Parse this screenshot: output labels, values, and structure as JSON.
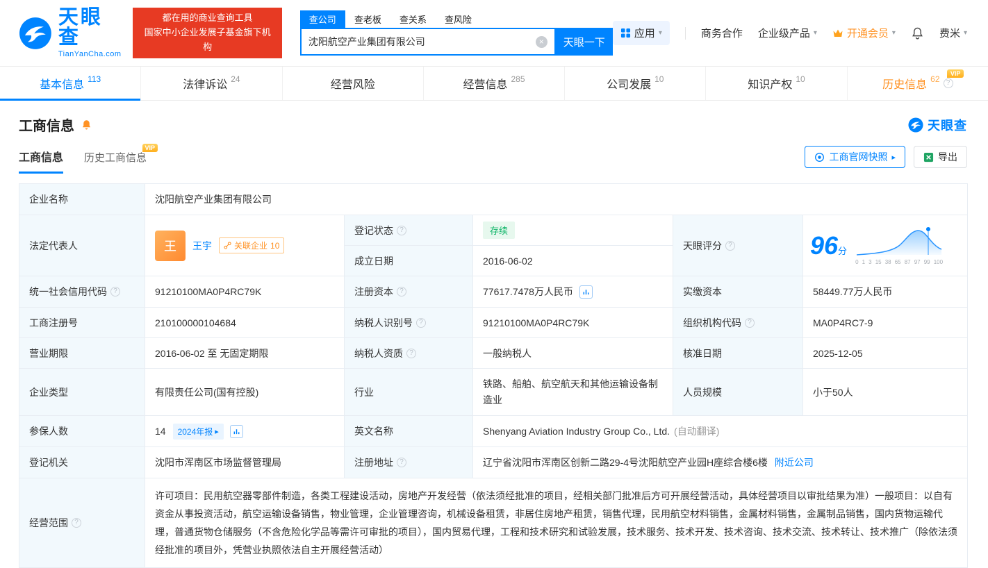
{
  "colors": {
    "brand_blue": "#0084ff",
    "vip_orange": "#ff9224",
    "status_green": "#0fb568",
    "promo_red": "#e73a23"
  },
  "vip_label": "VIP",
  "header": {
    "logo": {
      "brand": "天眼查",
      "domain": "TianYanCha.com"
    },
    "slogan": {
      "line1": "都在用的商业查询工具",
      "line2": "国家中小企业发展子基金旗下机构"
    },
    "search": {
      "tabs": [
        {
          "label": "查公司"
        },
        {
          "label": "查老板"
        },
        {
          "label": "查关系"
        },
        {
          "label": "查风险"
        }
      ],
      "value": "沈阳航空产业集团有限公司",
      "button": "天眼一下"
    },
    "menu": {
      "apps": "应用",
      "cooperation": "商务合作",
      "enterprise": "企业级产品",
      "vip": "开通会员",
      "user": "费米"
    }
  },
  "nav_tabs": [
    {
      "label": "基本信息",
      "count": "113"
    },
    {
      "label": "法律诉讼",
      "count": "24"
    },
    {
      "label": "经营风险",
      "count": ""
    },
    {
      "label": "经营信息",
      "count": "285"
    },
    {
      "label": "公司发展",
      "count": "10"
    },
    {
      "label": "知识产权",
      "count": "10"
    },
    {
      "label": "历史信息",
      "count": "62"
    }
  ],
  "section": {
    "title": "工商信息",
    "brand": "天眼查",
    "sub_tabs": [
      {
        "label": "工商信息"
      },
      {
        "label": "历史工商信息"
      }
    ],
    "actions": {
      "snapshot": "工商官网快照",
      "export": "导出"
    }
  },
  "table": {
    "company_name": {
      "label": "企业名称",
      "value": "沈阳航空产业集团有限公司"
    },
    "legal_rep": {
      "label": "法定代表人",
      "avatar_text": "王",
      "name": "王宇",
      "tag": "关联企业",
      "tag_count": "10"
    },
    "reg_status": {
      "label": "登记状态",
      "value": "存续"
    },
    "establish_date": {
      "label": "成立日期",
      "value": "2016-06-02"
    },
    "score": {
      "label": "天眼评分",
      "value": "96",
      "unit": "分",
      "axis": [
        "0",
        "1",
        "3",
        "15",
        "38",
        "65",
        "87",
        "97",
        "99",
        "100"
      ]
    },
    "credit_code": {
      "label": "统一社会信用代码",
      "value": "91210100MA0P4RC79K"
    },
    "reg_capital": {
      "label": "注册资本",
      "value": "77617.7478万人民币"
    },
    "paid_capital": {
      "label": "实缴资本",
      "value": "58449.77万人民币"
    },
    "reg_number": {
      "label": "工商注册号",
      "value": "210100000104684"
    },
    "taxpayer_id": {
      "label": "纳税人识别号",
      "value": "91210100MA0P4RC79K"
    },
    "org_code": {
      "label": "组织机构代码",
      "value": "MA0P4RC7-9"
    },
    "business_term": {
      "label": "营业期限",
      "value": "2016-06-02 至 无固定期限"
    },
    "taxpayer_quality": {
      "label": "纳税人资质",
      "value": "一般纳税人"
    },
    "approval_date": {
      "label": "核准日期",
      "value": "2025-12-05"
    },
    "company_type": {
      "label": "企业类型",
      "value": "有限责任公司(国有控股)"
    },
    "industry": {
      "label": "行业",
      "value": "铁路、船舶、航空航天和其他运输设备制造业"
    },
    "staff_size": {
      "label": "人员规模",
      "value": "小于50人"
    },
    "insured": {
      "label": "参保人数",
      "value": "14",
      "badge": "2024年报"
    },
    "english_name": {
      "label": "英文名称",
      "value": "Shenyang Aviation Industry Group Co., Ltd.",
      "note": "(自动翻译)"
    },
    "reg_authority": {
      "label": "登记机关",
      "value": "沈阳市浑南区市场监督管理局"
    },
    "address": {
      "label": "注册地址",
      "value": "辽宁省沈阳市浑南区创新二路29-4号沈阳航空产业园H座综合楼6楼",
      "link": "附近公司"
    },
    "business_scope": {
      "label": "经营范围",
      "value": "许可项目：民用航空器零部件制造，各类工程建设活动，房地产开发经营（依法须经批准的项目，经相关部门批准后方可开展经营活动，具体经营项目以审批结果为准）一般项目：以自有资金从事投资活动，航空运输设备销售，物业管理，企业管理咨询，机械设备租赁，非居住房地产租赁，销售代理，民用航空材料销售，金属材料销售，金属制品销售，国内货物运输代理，普通货物仓储服务（不含危险化学品等需许可审批的项目），国内贸易代理，工程和技术研究和试验发展，技术服务、技术开发、技术咨询、技术交流、技术转让、技术推广（除依法须经批准的项目外，凭营业执照依法自主开展经营活动）"
    }
  }
}
